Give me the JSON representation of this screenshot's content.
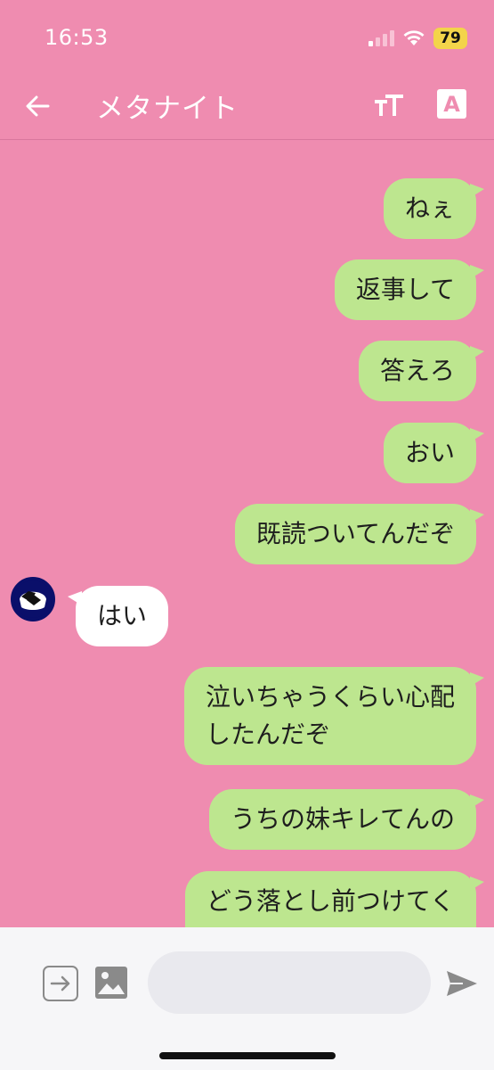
{
  "status_bar": {
    "time": "16:53",
    "battery": "79"
  },
  "header": {
    "title": "メタナイト",
    "font_button_label": "A"
  },
  "messages": [
    {
      "sender": "me",
      "text": "ねぇ"
    },
    {
      "sender": "me",
      "text": "返事して"
    },
    {
      "sender": "me",
      "text": "答えろ"
    },
    {
      "sender": "me",
      "text": "おい"
    },
    {
      "sender": "me",
      "text": "既読ついてんだぞ"
    },
    {
      "sender": "other",
      "text": "はい"
    },
    {
      "sender": "me",
      "text": "泣いちゃうくらい心配\nしたんだぞ"
    },
    {
      "sender": "me",
      "text": "うちの妹キレてんの"
    },
    {
      "sender": "me",
      "text": "どう落とし前つけてく"
    }
  ],
  "input": {
    "value": "",
    "placeholder": ""
  },
  "colors": {
    "background": "#ef8cb0",
    "sent_bubble": "#bde68f",
    "received_bubble": "#ffffff",
    "avatar": "#0a0f6a"
  },
  "icons": {
    "back": "arrow-left-icon",
    "font_size": "text-size-icon",
    "font": "font-a-icon",
    "share": "arrow-right-box-icon",
    "image": "image-icon",
    "send": "send-icon"
  }
}
